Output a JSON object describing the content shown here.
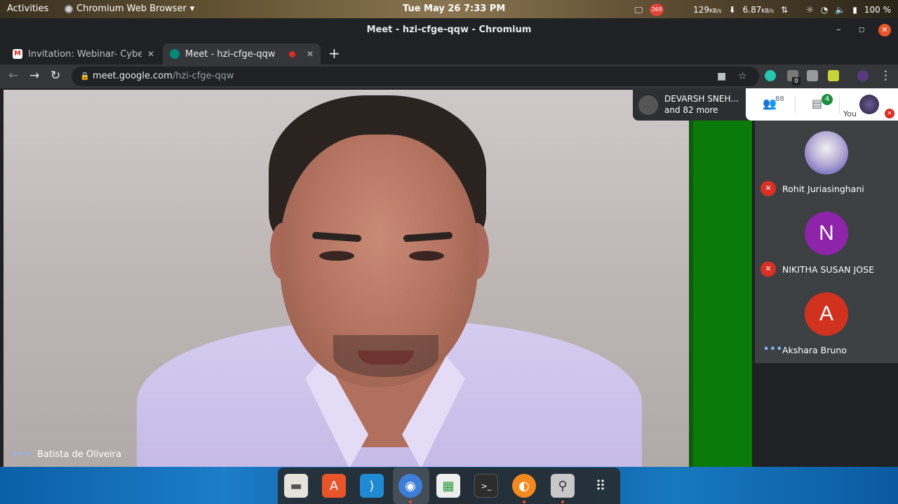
{
  "system_bar": {
    "activities": "Activities",
    "app_name": "Chromium Web Browser",
    "clock": "Tue May 26  7:33 PM",
    "badge_count": "269",
    "net_down": "129",
    "net_down_unit": "KB/s",
    "net_up": "6.87",
    "net_up_unit": "KB/s",
    "battery": "100 %"
  },
  "window": {
    "title": "Meet - hzi-cfge-qqw - Chromium"
  },
  "tabs": [
    {
      "title": "Invitation: Webinar- Cyber",
      "close": "✕"
    },
    {
      "title": "Meet - hzi-cfge-qqw",
      "close": "✕"
    }
  ],
  "address": {
    "host": "meet.google.com",
    "path": "/hzi-cfge-qqw"
  },
  "extensions": {
    "badge": "0"
  },
  "meet": {
    "presenter_card": {
      "name": "DEVARSH SNEH...",
      "more": "and 82 more"
    },
    "people_count": "88",
    "chat_badge": "4",
    "self_label": "You",
    "main_speaker": "Batista de Oliveira",
    "participants": [
      {
        "name": "Rohit Juriasinghani",
        "initial": "",
        "color": "#6b6bd0",
        "muted": true
      },
      {
        "name": "NIKITHA SUSAN JOSE",
        "initial": "N",
        "color": "#8e24aa",
        "muted": true
      },
      {
        "name": "Akshara Bruno",
        "initial": "A",
        "color": "#d0321f",
        "muted": false
      }
    ]
  },
  "colors": {
    "accent_green": "#0a7a0a",
    "mute_red": "#d93025",
    "speaking_blue": "#8ab4f8"
  }
}
